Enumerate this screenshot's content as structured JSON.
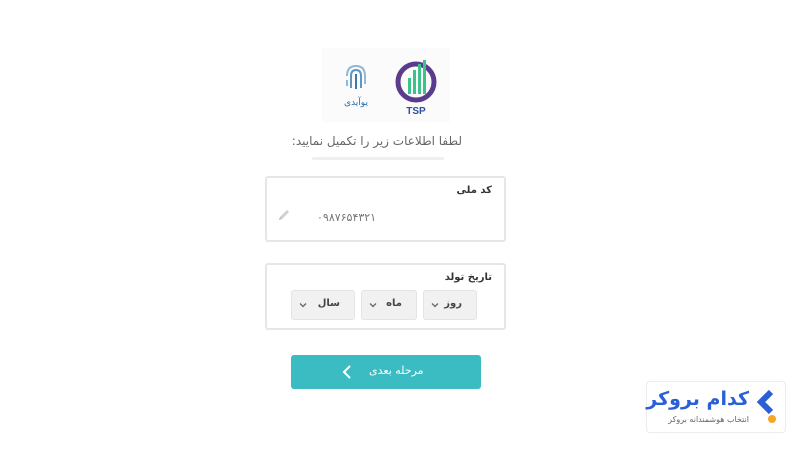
{
  "logos": {
    "uid_text": "یوآیدی",
    "tsp_text": "TSP"
  },
  "form": {
    "instruction": "لطفا اطلاعات زیر را تکمیل نمایید:",
    "national_id": {
      "label": "کد ملی",
      "placeholder": "۰۹۸۷۶۵۴۳۲۱"
    },
    "birth_date": {
      "label": "تاریخ تولد",
      "year_label": "سال",
      "month_label": "ماه",
      "day_label": "روز"
    },
    "next_button": "مرحله بعدی"
  },
  "watermark": {
    "title": "کدام بروکر",
    "subtitle": "انتخاب هوشمندانه بروکر"
  },
  "colors": {
    "button_bg": "#3bbcc3",
    "brand_blue": "#2a5fd6",
    "accent_orange": "#f5a623"
  }
}
